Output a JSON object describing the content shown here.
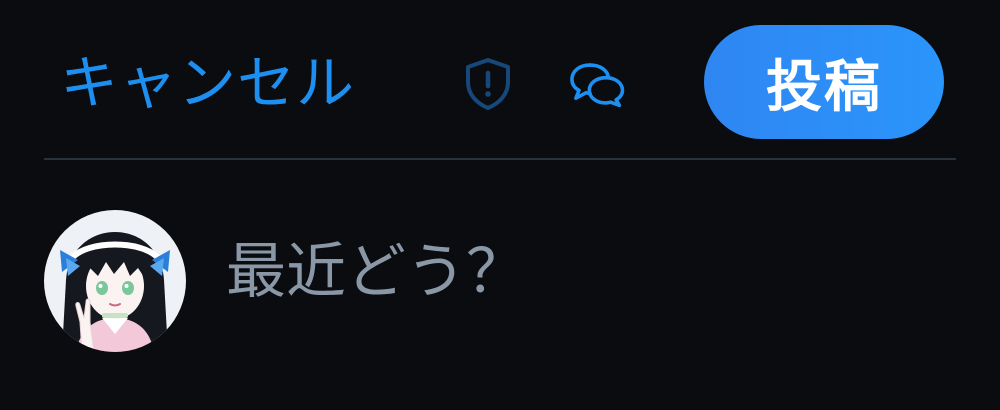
{
  "header": {
    "cancel_label": "キャンセル",
    "post_label": "投稿",
    "icons": {
      "shield": "shield-alert-icon",
      "chat": "chat-bubbles-icon"
    }
  },
  "composer": {
    "placeholder": "最近どう？"
  },
  "colors": {
    "background": "#0a0c10",
    "accent": "#1d8ff0",
    "post_button": "#2f86f2",
    "placeholder": "#8a97a6",
    "divider": "#2a323d"
  }
}
